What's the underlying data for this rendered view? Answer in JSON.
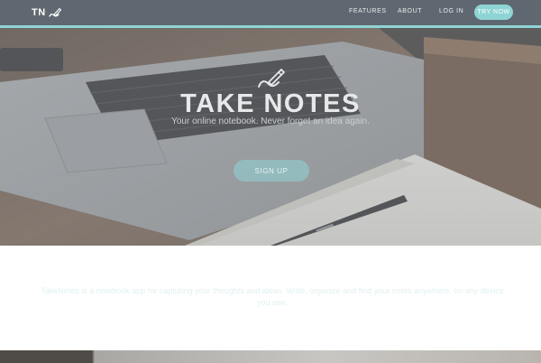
{
  "nav": {
    "logo_text": "TN",
    "links": [
      "FEATURES",
      "ABOUT",
      "LOG IN"
    ],
    "cta_label": "TRY NOW"
  },
  "hero": {
    "title": "TAKE NOTES",
    "subtitle": "Your online notebook. Never forget an idea again.",
    "button_label": "SIGN UP",
    "icon": "notebook-pencil-icon"
  },
  "intro": {
    "text": "TakeNotes is a notebook app for capturing your thoughts and ideas. Write, organize and find your notes anywhere, on any device you use."
  },
  "colors": {
    "accent": "#8fd4d5",
    "navbar": "#5f6870"
  }
}
